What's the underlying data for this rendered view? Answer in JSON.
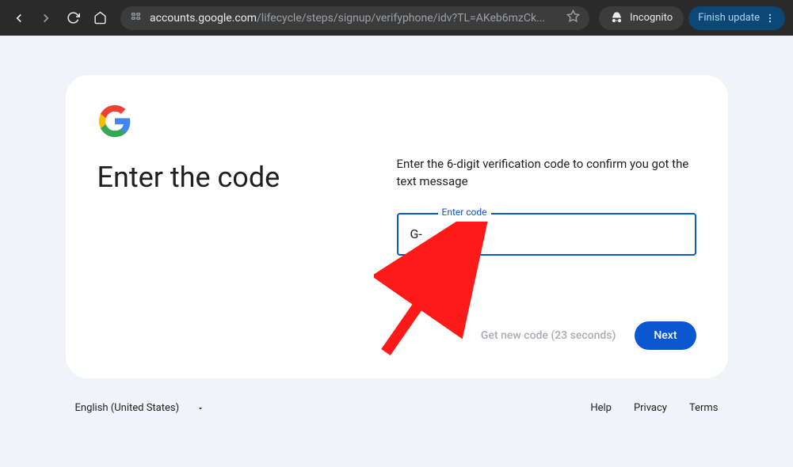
{
  "browser": {
    "url_domain": "accounts.google.com",
    "url_path": "/lifecycle/steps/signup/verifyphone/idv?TL=AKeb6mzCk...",
    "incognito_label": "Incognito",
    "update_label": "Finish update"
  },
  "page": {
    "title": "Enter the code",
    "subtitle": "Enter the 6-digit verification code to confirm you got the text message",
    "input_label": "Enter code",
    "input_value": "G-",
    "get_new_code": "Get new code (23 seconds)",
    "next_button": "Next"
  },
  "footer": {
    "language": "English (United States)",
    "links": {
      "help": "Help",
      "privacy": "Privacy",
      "terms": "Terms"
    }
  }
}
